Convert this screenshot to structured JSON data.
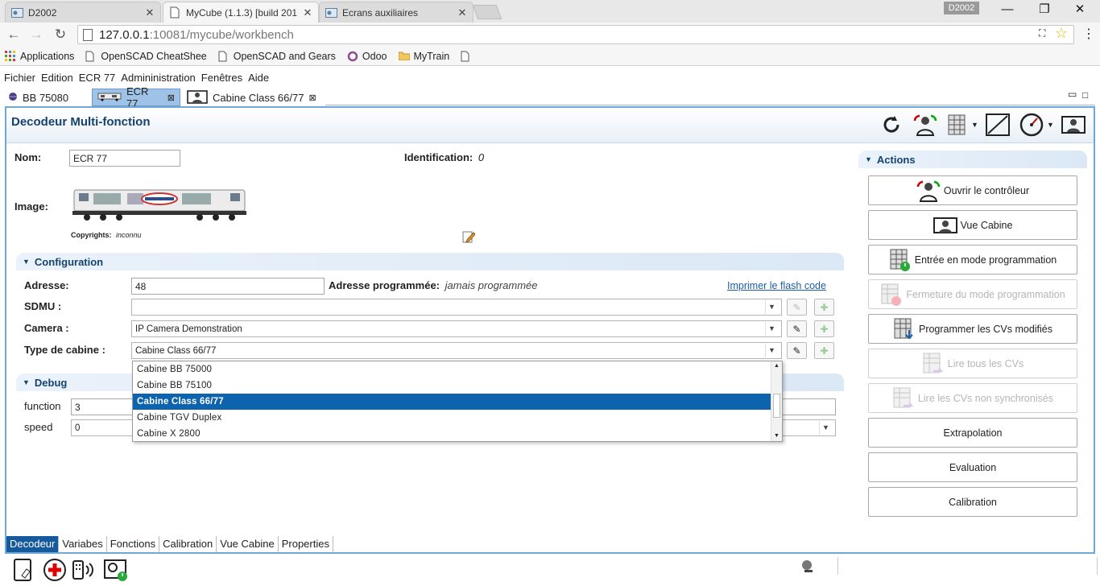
{
  "browser": {
    "tabs": [
      {
        "title": "D2002",
        "favicon": "web-icon"
      },
      {
        "title": "MyCube (1.1.3) [build 201",
        "favicon": "doc-icon"
      },
      {
        "title": "Ecrans auxiliaires",
        "favicon": "web-icon"
      }
    ],
    "window_user": "D2002",
    "url_host": "127.0.0.1",
    "url_path": ":10081/mycube/workbench",
    "bookmarks": [
      "Applications",
      "OpenSCAD CheatShee",
      "OpenSCAD and Gears",
      "Odoo",
      "MyTrain",
      ""
    ]
  },
  "app": {
    "menu": [
      "Fichier",
      "Edition",
      "ECR 77",
      "Admininistration",
      "Fenêtres",
      "Aide"
    ],
    "editor_tabs": [
      "BB 75080",
      "ECR 77",
      "Cabine Class 66/77"
    ],
    "title": "Decodeur Multi-fonction",
    "form": {
      "nom_label": "Nom:",
      "nom_value": "ECR 77",
      "identification_label": "Identification:",
      "identification_value": "0",
      "image_label": "Image:",
      "copyrights_label": "Copyrights:",
      "copyrights_value": "inconnu"
    },
    "configuration": {
      "title": "Configuration",
      "adresse_label": "Adresse:",
      "adresse_value": "48",
      "adresse_prog_label": "Adresse programmée:",
      "adresse_prog_value": "jamais programmée",
      "flash_link": "Imprimer le flash code",
      "sdmu_label": "SDMU :",
      "sdmu_value": "",
      "camera_label": "Camera :",
      "camera_value": "IP Camera Demonstration",
      "cabine_label": "Type de cabine :",
      "cabine_value": "Cabine Class 66/77",
      "cabine_options": [
        "Cabine BB 75000",
        "Cabine BB 75100",
        "Cabine Class 66/77",
        "Cabine TGV Duplex",
        "Cabine X 2800"
      ],
      "cabine_selected_index": 2
    },
    "debug": {
      "title": "Debug",
      "function_label": "function",
      "function_value": "3",
      "speed_label": "speed",
      "speed_value": "0"
    },
    "actions": {
      "title": "Actions",
      "buttons": [
        {
          "label": "Ouvrir le contrôleur",
          "enabled": true,
          "icon": "controller-icon"
        },
        {
          "label": "Vue Cabine",
          "enabled": true,
          "icon": "cabin-icon"
        },
        {
          "label": "Entrée en mode programmation",
          "enabled": true,
          "icon": "program-on-icon"
        },
        {
          "label": "Fermeture du mode programmation",
          "enabled": false,
          "icon": "program-off-icon"
        },
        {
          "label": "Programmer les CVs modifiés",
          "enabled": true,
          "icon": "program-cv-icon"
        },
        {
          "label": "Lire tous les CVs",
          "enabled": false,
          "icon": "read-cv-icon"
        },
        {
          "label": "Lire les CVs non synchronisés",
          "enabled": false,
          "icon": "read-unsync-icon"
        },
        {
          "label": "Extrapolation",
          "enabled": true,
          "icon": ""
        },
        {
          "label": "Evaluation",
          "enabled": true,
          "icon": ""
        },
        {
          "label": "Calibration",
          "enabled": true,
          "icon": ""
        }
      ]
    },
    "bottom_tabs": [
      "Decodeur",
      "Variabes",
      "Fonctions",
      "Calibration",
      "Vue Cabine",
      "Properties"
    ]
  },
  "colors": {
    "accent": "#0d63ae",
    "header_text": "#16426e",
    "link": "#1a5ea8"
  }
}
